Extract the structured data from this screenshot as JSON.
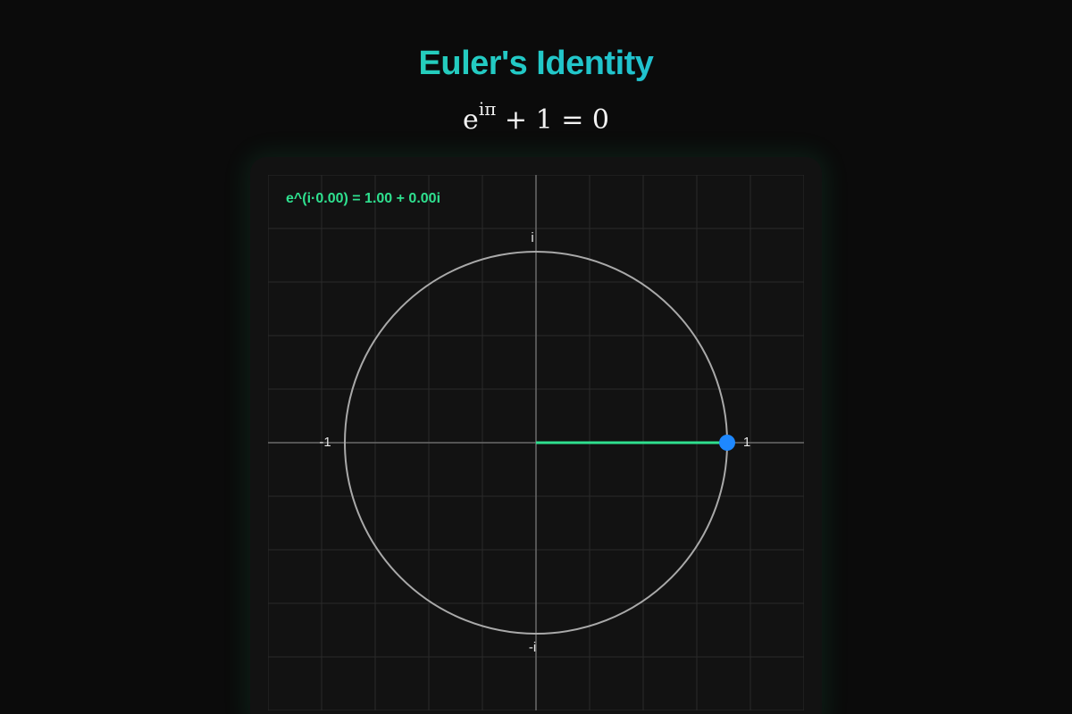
{
  "header": {
    "title": "Euler's Identity",
    "formula": {
      "base": "e",
      "exponent": "iπ",
      "rest": " + 1 = 0"
    }
  },
  "plane": {
    "readout": "e^(i·0.00) = 1.00 + 0.00i",
    "labels": {
      "imag_pos": "i",
      "imag_neg": "-i",
      "real_pos": "1",
      "real_neg": "-1"
    },
    "angle": 0.0,
    "point": {
      "re": 1.0,
      "im": 0.0
    },
    "colors": {
      "grid": "#2a2a2a",
      "axis": "#6a6a6a",
      "circle": "#a9a9a9",
      "vector": "#2fe08f",
      "point": "#1e88ff"
    },
    "grid": true
  }
}
